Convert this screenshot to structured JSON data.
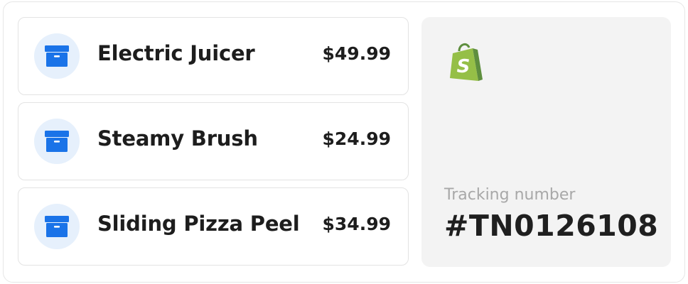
{
  "items": [
    {
      "name": "Electric Juicer",
      "price": "$49.99",
      "icon": "package-icon"
    },
    {
      "name": "Steamy Brush",
      "price": "$24.99",
      "icon": "package-icon"
    },
    {
      "name": "Sliding Pizza Peel",
      "price": "$34.99",
      "icon": "package-icon"
    }
  ],
  "tracking": {
    "label": "Tracking number",
    "number": "#TN0126108"
  },
  "brand": {
    "logo": "shopify-bag-icon",
    "logo_letter": "S"
  },
  "colors": {
    "accent_blue": "#1a73e8",
    "icon_circle_bg": "#e6f0fc",
    "logo_green": "#95bf47",
    "logo_dark_green": "#5e8e3e",
    "side_panel_bg": "#f3f3f3"
  }
}
